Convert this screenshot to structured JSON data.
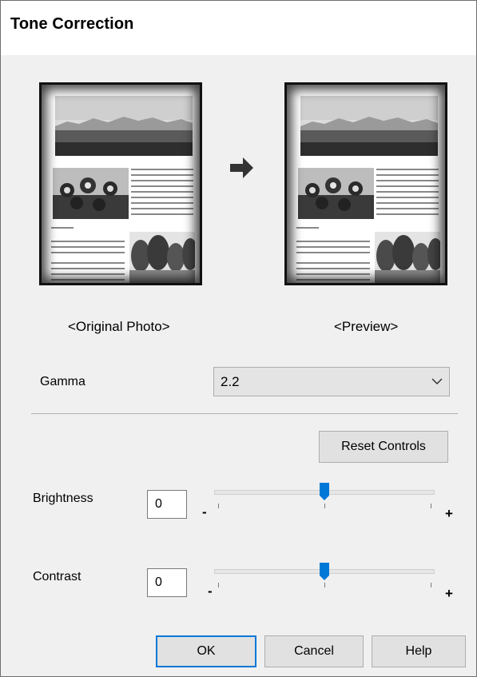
{
  "dialog": {
    "title": "Tone Correction"
  },
  "thumbnails": {
    "original_caption": "<Original Photo>",
    "preview_caption": "<Preview>"
  },
  "gamma": {
    "label": "Gamma",
    "value": "2.2"
  },
  "reset_button": "Reset Controls",
  "brightness": {
    "label": "Brightness",
    "value": "0",
    "min_symbol": "-",
    "max_symbol": "+",
    "level": 0.5
  },
  "contrast": {
    "label": "Contrast",
    "value": "0",
    "min_symbol": "-",
    "max_symbol": "+",
    "level": 0.5
  },
  "buttons": {
    "ok": "OK",
    "cancel": "Cancel",
    "help": "Help"
  },
  "colors": {
    "accent": "#0078d7"
  }
}
